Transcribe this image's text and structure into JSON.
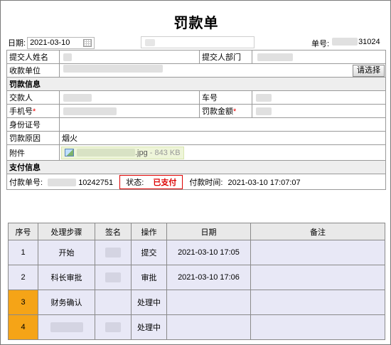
{
  "title": "罚款单",
  "header": {
    "date_label": "日期:",
    "date_value": "2021-03-10",
    "docno_label": "单号:",
    "docno_suffix": "31024"
  },
  "form": {
    "submitter_name_label": "提交人姓名",
    "submitter_dept_label": "提交人部门",
    "receiver_unit_label": "收款单位",
    "select_button": "请选择",
    "section_fine": "罚款信息",
    "payer_label": "交款人",
    "car_no_label": "车号",
    "phone_label": "手机号",
    "amount_label": "罚款金额",
    "id_label": "身份证号",
    "reason_label": "罚款原因",
    "reason_value": "烟火",
    "attachment_label": "附件",
    "attachment_ext": ".jpg",
    "attachment_size": "- 843 KB",
    "required_mark": "*",
    "section_pay": "支付信息",
    "pay_no_label": "付款单号:",
    "pay_no_suffix": "10242751",
    "status_label": "状态:",
    "status_value": "已支付",
    "pay_time_label": "付款时间:",
    "pay_time_value": "2021-03-10 17:07:07"
  },
  "flow": {
    "columns": [
      "序号",
      "处理步骤",
      "签名",
      "操作",
      "日期",
      "备注"
    ],
    "rows": [
      {
        "idx": "1",
        "step": "开始",
        "action": "提交",
        "date": "2021-03-10 17:05",
        "highlight": false
      },
      {
        "idx": "2",
        "step": "科长审批",
        "action": "审批",
        "date": "2021-03-10 17:06",
        "highlight": false
      },
      {
        "idx": "3",
        "step": "财务确认",
        "action": "处理中",
        "date": "",
        "highlight": true
      },
      {
        "idx": "4",
        "step": "",
        "action": "处理中",
        "date": "",
        "highlight": true
      }
    ]
  },
  "colors": {
    "highlight": "#f5a417",
    "status_red": "#dd0000",
    "row_bg": "#e8e8f6"
  }
}
